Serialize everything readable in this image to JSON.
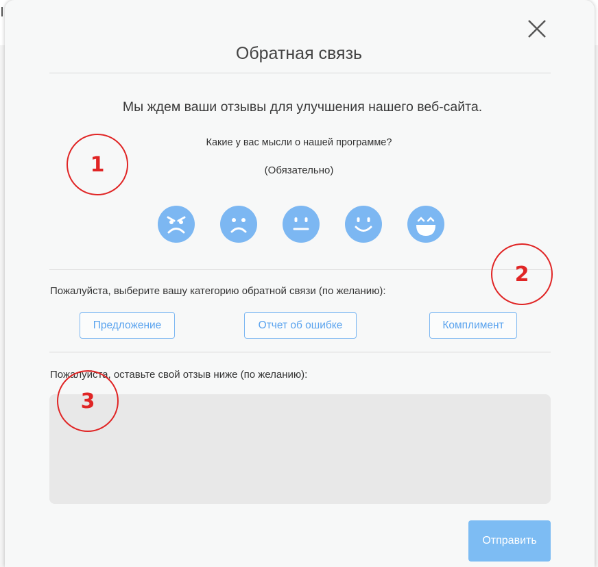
{
  "dialog": {
    "title": "Обратная связь",
    "subtitle": "Мы ждем ваши отзывы для улучшения нашего веб-сайта.",
    "question": "Какие у вас мысли о нашей программе?",
    "required": "(Обязательно)",
    "ratings": [
      {
        "icon": "angry-face-icon"
      },
      {
        "icon": "sad-face-icon"
      },
      {
        "icon": "neutral-face-icon"
      },
      {
        "icon": "smile-face-icon"
      },
      {
        "icon": "happy-face-icon"
      }
    ],
    "category_label": "Пожалуйста, выберите вашу категорию обратной связи (по желанию):",
    "categories": [
      "Предложение",
      "Отчет об ошибке",
      "Комплимент"
    ],
    "feedback_label": "Пожалуйста, оставьте свой отзыв ниже (по желанию):",
    "feedback_value": "",
    "submit_label": "Отправить"
  },
  "annotations": [
    "1",
    "2",
    "3"
  ],
  "colors": {
    "accent": "#7cb7f2",
    "marker": "#e02525",
    "textarea_bg": "#e8e8e8",
    "dialog_bg": "#f7f8f8"
  }
}
